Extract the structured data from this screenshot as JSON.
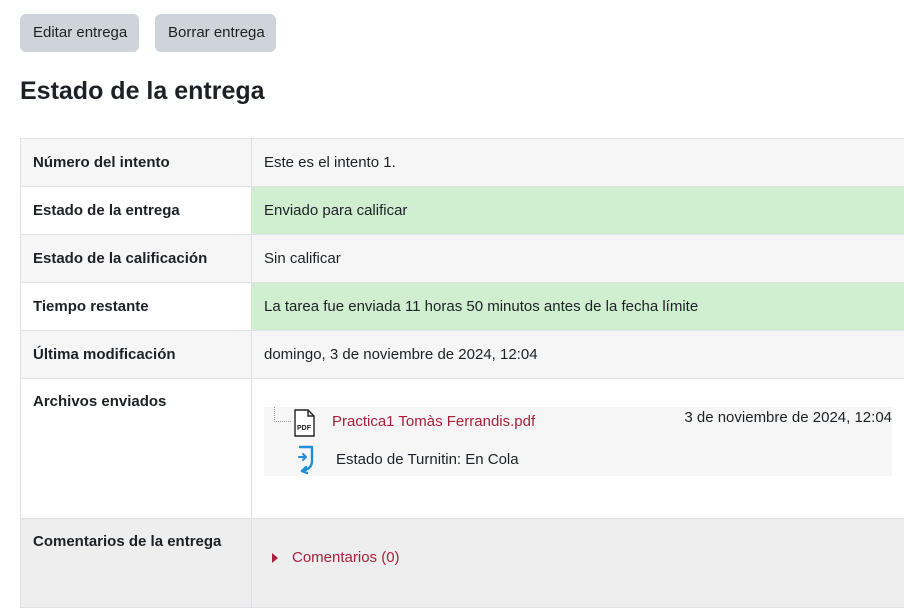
{
  "actions": {
    "edit_label": "Editar entrega",
    "delete_label": "Borrar entrega"
  },
  "heading": "Estado de la entrega",
  "status_rows": [
    {
      "label": "Número del intento",
      "value": "Este es el intento 1."
    },
    {
      "label": "Estado de la entrega",
      "value": "Enviado para calificar"
    },
    {
      "label": "Estado de la calificación",
      "value": "Sin calificar"
    },
    {
      "label": "Tiempo restante",
      "value": "La tarea fue enviada 11 horas 50 minutos antes de la fecha límite"
    },
    {
      "label": "Última modificación",
      "value": "domingo, 3 de noviembre de 2024, 12:04"
    }
  ],
  "files": {
    "label": "Archivos enviados",
    "file_name": "Practica1 Tomàs Ferrandis.pdf",
    "file_date": "3 de noviembre de 2024, 12:04",
    "turnitin_status": "Estado de Turnitin: En Cola",
    "icon_file": "pdf-file-icon",
    "icon_turnitin": "turnitin-icon"
  },
  "comments": {
    "label": "Comentarios de la entrega",
    "toggle": "Comentarios (0)"
  },
  "colors": {
    "success_bg": "#d0efd1",
    "link": "#a8203d",
    "button_bg": "#ced4da"
  }
}
